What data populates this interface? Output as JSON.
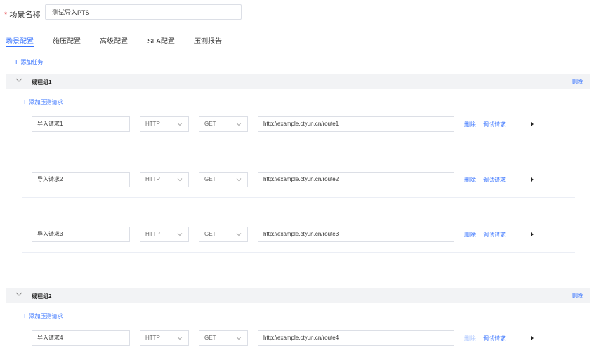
{
  "scene": {
    "required_mark": "*",
    "label": "场景名称",
    "value": "测试导入PTS"
  },
  "tabs": [
    {
      "label": "场景配置",
      "active": true
    },
    {
      "label": "施压配置",
      "active": false
    },
    {
      "label": "高级配置",
      "active": false
    },
    {
      "label": "SLA配置",
      "active": false
    },
    {
      "label": "压测报告",
      "active": false
    }
  ],
  "add_task_label": "添加任务",
  "groups": [
    {
      "title": "线程组1",
      "delete_label": "删除",
      "add_request_label": "添加压测请求",
      "requests": [
        {
          "name": "导入请求1",
          "protocol": "HTTP",
          "method": "GET",
          "url": "http://example.ctyun.cn/route1",
          "delete_label": "删除",
          "debug_label": "调试请求",
          "delete_enabled": true
        },
        {
          "name": "导入请求2",
          "protocol": "HTTP",
          "method": "GET",
          "url": "http://example.ctyun.cn/route2",
          "delete_label": "删除",
          "debug_label": "调试请求",
          "delete_enabled": true
        },
        {
          "name": "导入请求3",
          "protocol": "HTTP",
          "method": "GET",
          "url": "http://example.ctyun.cn/route3",
          "delete_label": "删除",
          "debug_label": "调试请求",
          "delete_enabled": true
        }
      ]
    },
    {
      "title": "线程组2",
      "delete_label": "删除",
      "add_request_label": "添加压测请求",
      "requests": [
        {
          "name": "导入请求4",
          "protocol": "HTTP",
          "method": "GET",
          "url": "http://example.ctyun.cn/route4",
          "delete_label": "删除",
          "debug_label": "调试请求",
          "delete_enabled": false
        }
      ]
    }
  ],
  "colors": {
    "accent": "#3370ff",
    "required": "#e5484d",
    "header_bg": "#f2f3f5"
  },
  "icons": {
    "collapse": "chevron-down-icon",
    "add": "plus-icon",
    "expand": "play-arrow-icon",
    "select": "chevron-down-icon"
  }
}
